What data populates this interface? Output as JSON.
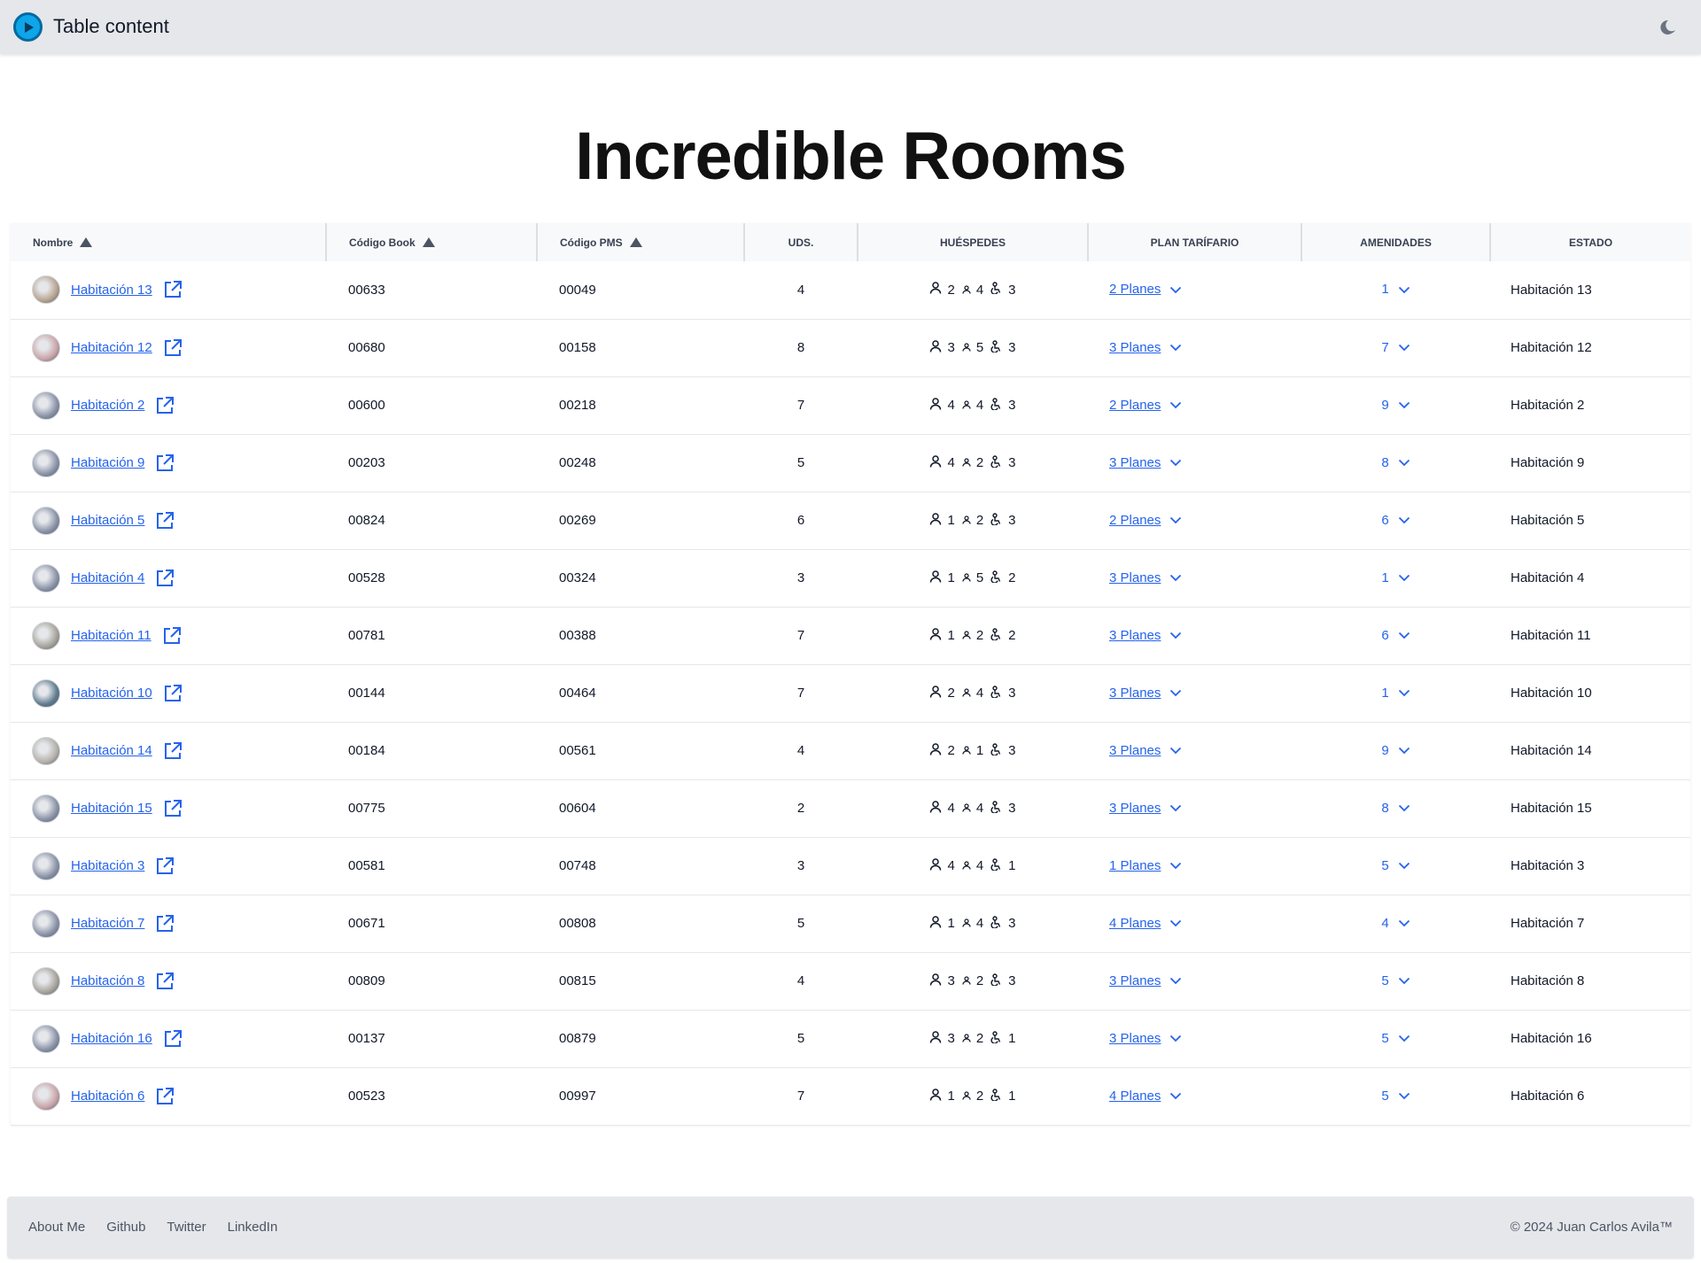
{
  "header": {
    "app_title": "Table content"
  },
  "page": {
    "title": "Incredible Rooms"
  },
  "table": {
    "columns": {
      "nombre": "Nombre",
      "codigo_book": "Código Book",
      "codigo_pms": "Código PMS",
      "uds": "UDS.",
      "huespedes": "HUÉSPEDES",
      "plan": "PLAN TARÍFARIO",
      "amenidades": "AMENIDADES",
      "estado": "ESTADO"
    },
    "rows": [
      {
        "name": "Habitación 13",
        "book": "00633",
        "pms": "00049",
        "uds": "4",
        "adults": "2",
        "kids": "4",
        "infants": "3",
        "plans": "2 Planes",
        "amenities": "1",
        "estado": "Habitación 13",
        "avatar": "#b9a390"
      },
      {
        "name": "Habitación 12",
        "book": "00680",
        "pms": "00158",
        "uds": "8",
        "adults": "3",
        "kids": "5",
        "infants": "3",
        "plans": "3 Planes",
        "amenities": "7",
        "estado": "Habitación 12",
        "avatar": "#c9a4a8"
      },
      {
        "name": "Habitación 2",
        "book": "00600",
        "pms": "00218",
        "uds": "7",
        "adults": "4",
        "kids": "4",
        "infants": "3",
        "plans": "2 Planes",
        "amenities": "9",
        "estado": "Habitación 2",
        "avatar": "#8a92a6"
      },
      {
        "name": "Habitación 9",
        "book": "00203",
        "pms": "00248",
        "uds": "5",
        "adults": "4",
        "kids": "2",
        "infants": "3",
        "plans": "3 Planes",
        "amenities": "8",
        "estado": "Habitación 9",
        "avatar": "#8a92a6"
      },
      {
        "name": "Habitación 5",
        "book": "00824",
        "pms": "00269",
        "uds": "6",
        "adults": "1",
        "kids": "2",
        "infants": "3",
        "plans": "2 Planes",
        "amenities": "6",
        "estado": "Habitación 5",
        "avatar": "#8a92a6"
      },
      {
        "name": "Habitación 4",
        "book": "00528",
        "pms": "00324",
        "uds": "3",
        "adults": "1",
        "kids": "5",
        "infants": "2",
        "plans": "3 Planes",
        "amenities": "1",
        "estado": "Habitación 4",
        "avatar": "#8a92a6"
      },
      {
        "name": "Habitación 11",
        "book": "00781",
        "pms": "00388",
        "uds": "7",
        "adults": "1",
        "kids": "2",
        "infants": "2",
        "plans": "3 Planes",
        "amenities": "6",
        "estado": "Habitación 11",
        "avatar": "#a7a39b"
      },
      {
        "name": "Habitación 10",
        "book": "00144",
        "pms": "00464",
        "uds": "7",
        "adults": "2",
        "kids": "4",
        "infants": "3",
        "plans": "3 Planes",
        "amenities": "1",
        "estado": "Habitación 10",
        "avatar": "#5f7b8e"
      },
      {
        "name": "Habitación 14",
        "book": "00184",
        "pms": "00561",
        "uds": "4",
        "adults": "2",
        "kids": "1",
        "infants": "3",
        "plans": "3 Planes",
        "amenities": "9",
        "estado": "Habitación 14",
        "avatar": "#b5b0aa"
      },
      {
        "name": "Habitación 15",
        "book": "00775",
        "pms": "00604",
        "uds": "2",
        "adults": "4",
        "kids": "4",
        "infants": "3",
        "plans": "3 Planes",
        "amenities": "8",
        "estado": "Habitación 15",
        "avatar": "#8a92a6"
      },
      {
        "name": "Habitación 3",
        "book": "00581",
        "pms": "00748",
        "uds": "3",
        "adults": "4",
        "kids": "4",
        "infants": "1",
        "plans": "1 Planes",
        "amenities": "5",
        "estado": "Habitación 3",
        "avatar": "#8a92a6"
      },
      {
        "name": "Habitación 7",
        "book": "00671",
        "pms": "00808",
        "uds": "5",
        "adults": "1",
        "kids": "4",
        "infants": "3",
        "plans": "4 Planes",
        "amenities": "4",
        "estado": "Habitación 7",
        "avatar": "#8a92a6"
      },
      {
        "name": "Habitación 8",
        "book": "00809",
        "pms": "00815",
        "uds": "4",
        "adults": "3",
        "kids": "2",
        "infants": "3",
        "plans": "3 Planes",
        "amenities": "5",
        "estado": "Habitación 8",
        "avatar": "#a7a39b"
      },
      {
        "name": "Habitación 16",
        "book": "00137",
        "pms": "00879",
        "uds": "5",
        "adults": "3",
        "kids": "2",
        "infants": "1",
        "plans": "3 Planes",
        "amenities": "5",
        "estado": "Habitación 16",
        "avatar": "#8a92a6"
      },
      {
        "name": "Habitación 6",
        "book": "00523",
        "pms": "00997",
        "uds": "7",
        "adults": "1",
        "kids": "2",
        "infants": "1",
        "plans": "4 Planes",
        "amenities": "5",
        "estado": "Habitación 6",
        "avatar": "#c9a4a8"
      }
    ]
  },
  "footer": {
    "links": [
      "About Me",
      "Github",
      "Twitter",
      "LinkedIn"
    ],
    "copyright": "© 2024 Juan Carlos Avila™"
  },
  "colors": {
    "link": "#2563eb",
    "topbar": "#e5e7eb",
    "logo": "#0ea5e9"
  },
  "icons": {
    "logo": "play-circle-icon",
    "theme": "moon-icon",
    "external": "external-link-icon",
    "adult": "adult-icon",
    "child": "child-icon",
    "infant": "infant-icon",
    "chevron": "chevron-down-icon",
    "sort": "sort-ascending-icon"
  }
}
